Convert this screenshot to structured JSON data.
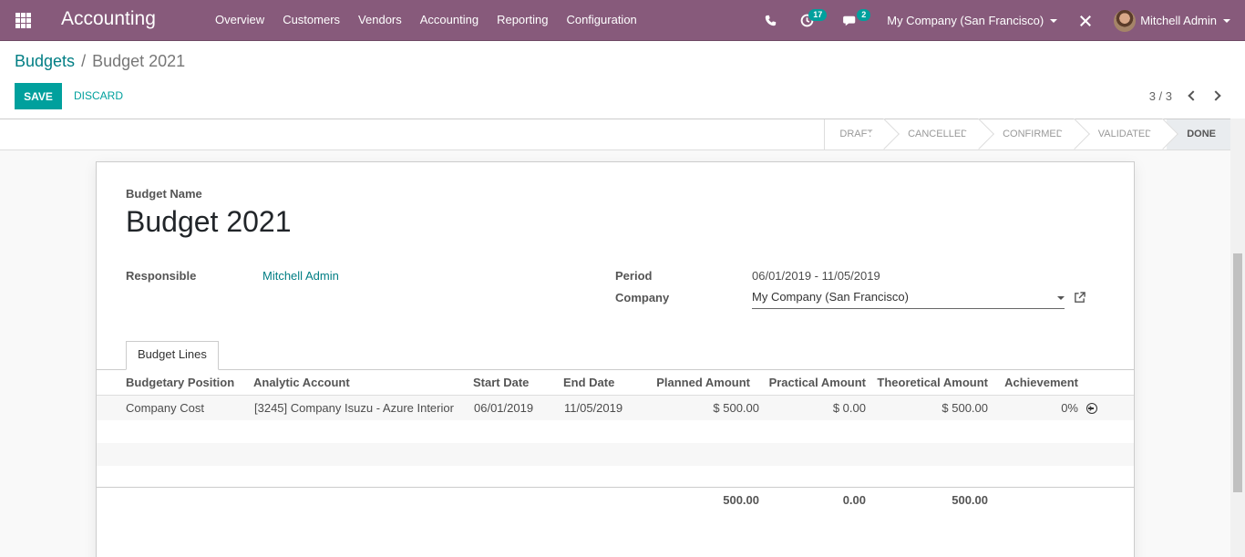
{
  "navbar": {
    "app_name": "Accounting",
    "menu": [
      "Overview",
      "Customers",
      "Vendors",
      "Accounting",
      "Reporting",
      "Configuration"
    ],
    "activity_count": "17",
    "messages_count": "2",
    "company": "My Company (San Francisco)",
    "user": "Mitchell Admin"
  },
  "breadcrumb": {
    "parent": "Budgets",
    "separator": "/",
    "current": "Budget 2021"
  },
  "buttons": {
    "save": "SAVE",
    "discard": "DISCARD"
  },
  "pager": {
    "value": "3 / 3"
  },
  "stages": [
    "DRAFT",
    "CANCELLED",
    "CONFIRMED",
    "VALIDATED",
    "DONE"
  ],
  "active_stage": "DONE",
  "form": {
    "name_label": "Budget Name",
    "name": "Budget 2021",
    "responsible_label": "Responsible",
    "responsible": "Mitchell Admin",
    "period_label": "Period",
    "period": "06/01/2019 - 11/05/2019",
    "company_label": "Company",
    "company": "My Company (San Francisco)"
  },
  "tab": "Budget Lines",
  "table": {
    "headers": [
      "Budgetary Position",
      "Analytic Account",
      "Start Date",
      "End Date",
      "Planned Amount",
      "Practical Amount",
      "Theoretical Amount",
      "Achievement"
    ],
    "rows": [
      [
        "Company Cost",
        "[3245] Company Isuzu - Azure Interior",
        "06/01/2019",
        "11/05/2019",
        "$ 500.00",
        "$ 0.00",
        "$ 500.00",
        "0%"
      ]
    ],
    "totals": {
      "planned": "500.00",
      "practical": "0.00",
      "theoretical": "500.00"
    }
  }
}
